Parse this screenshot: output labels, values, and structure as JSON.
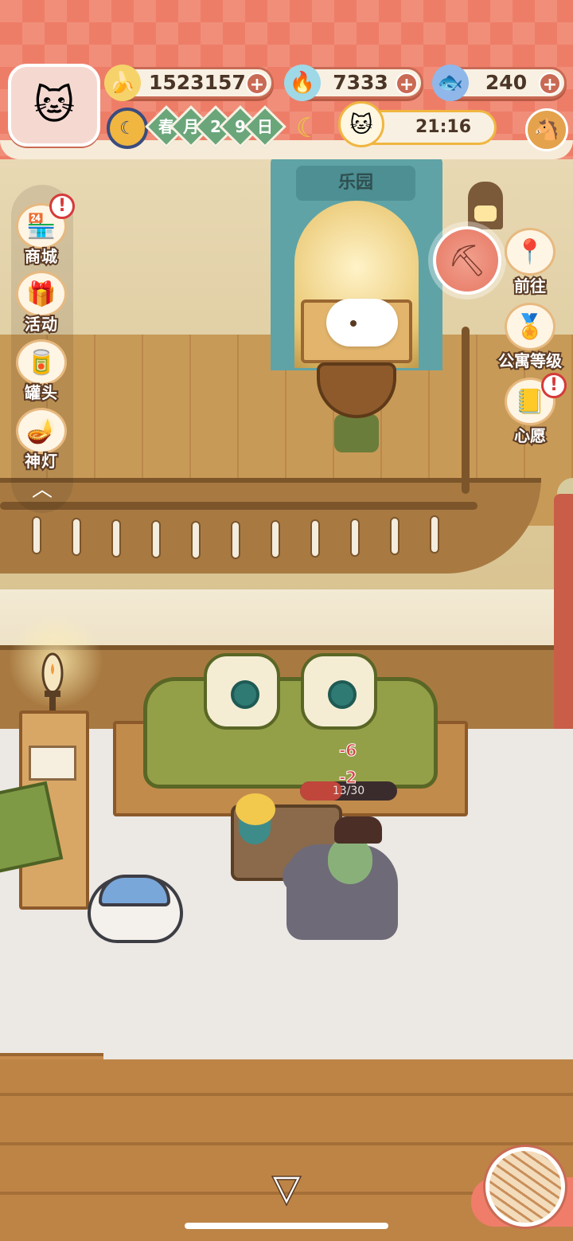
{
  "hud": {
    "resources": [
      {
        "icon": "banana-icon",
        "value": "1523157"
      },
      {
        "icon": "blue-flame-icon",
        "value": "7333"
      },
      {
        "icon": "blue-fish-icon",
        "value": "240"
      }
    ],
    "date": {
      "season": "春",
      "month": "月",
      "day_digits": [
        "2",
        "9"
      ],
      "day": "日"
    },
    "time": "21:16"
  },
  "left_menu": [
    {
      "label": "商城",
      "icon": "shop-icon",
      "alert": true
    },
    {
      "label": "活动",
      "icon": "gift-icon",
      "alert": false
    },
    {
      "label": "罐头",
      "icon": "can-icon",
      "alert": false
    },
    {
      "label": "神灯",
      "icon": "magic-lamp-icon",
      "alert": false
    }
  ],
  "right_menu": [
    {
      "label": "前往",
      "icon": "map-pin-icon",
      "alert": false
    },
    {
      "label": "公寓等级",
      "icon": "apartment-level-icon",
      "alert": false
    },
    {
      "label": "心愿",
      "icon": "wish-book-icon",
      "alert": true
    }
  ],
  "scene": {
    "gate_sign": "乐园",
    "damage_numbers": [
      "-6",
      "-2"
    ],
    "hp": {
      "current": 13,
      "max": 30,
      "text": "13/30"
    }
  },
  "colors": {
    "hud_band": "#ee7d68",
    "accent": "#c96a54",
    "menu_label_stroke": "#5b3b25"
  }
}
